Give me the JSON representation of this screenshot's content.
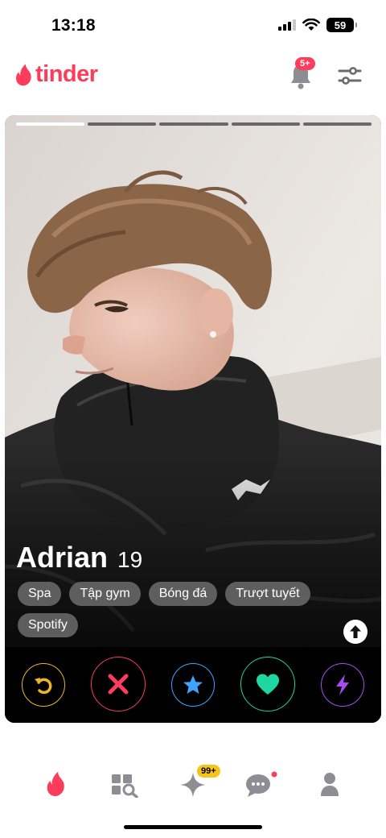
{
  "status_bar": {
    "time": "13:18",
    "battery": "59"
  },
  "header": {
    "logo_text": "tinder",
    "notification_badge": "5+",
    "brand_color": "#fd3b5a"
  },
  "card": {
    "photo_index": 1,
    "photo_count": 5,
    "name": "Adrian",
    "age": "19",
    "interests": [
      "Spa",
      "Tập gym",
      "Bóng đá",
      "Trượt tuyết",
      "Spotify"
    ]
  },
  "actions": [
    {
      "name": "rewind-button",
      "icon": "rewind-icon",
      "color": "#f0b429"
    },
    {
      "name": "nope-button",
      "icon": "x-icon",
      "color": "#fe3c5e"
    },
    {
      "name": "super-like-button",
      "icon": "star-icon",
      "color": "#3ea4ff"
    },
    {
      "name": "like-button",
      "icon": "heart-icon",
      "color": "#1ed7a0"
    },
    {
      "name": "boost-button",
      "icon": "lightning-icon",
      "color": "#a74cf2"
    }
  ],
  "tabbar": {
    "items": [
      "flame-icon",
      "explore-icon",
      "gold-likes-icon",
      "chat-icon",
      "profile-icon"
    ],
    "likes_badge": "99+"
  }
}
